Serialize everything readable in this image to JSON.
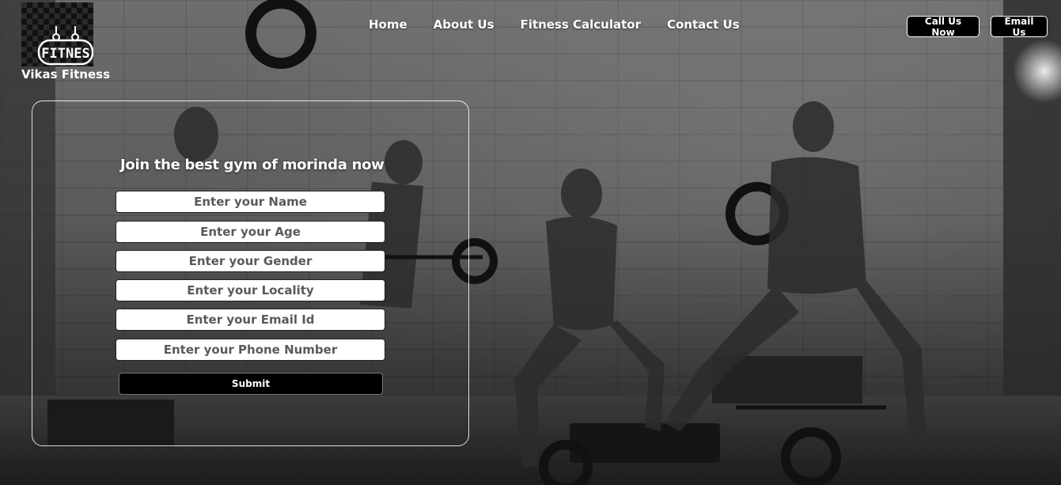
{
  "brand": {
    "logo_text": "FITNES",
    "name": "Vikas Fitness"
  },
  "nav": {
    "items": [
      {
        "label": "Home"
      },
      {
        "label": "About Us"
      },
      {
        "label": "Fitness Calculator"
      },
      {
        "label": "Contact Us"
      }
    ]
  },
  "actions": {
    "call_label": "Call Us Now",
    "email_label": "Email Us"
  },
  "form": {
    "title": "Join the best gym of morinda now",
    "fields": [
      {
        "placeholder": "Enter your Name",
        "value": ""
      },
      {
        "placeholder": "Enter your Age",
        "value": ""
      },
      {
        "placeholder": "Enter your Gender",
        "value": ""
      },
      {
        "placeholder": "Enter your Locality",
        "value": ""
      },
      {
        "placeholder": "Enter your Email Id",
        "value": ""
      },
      {
        "placeholder": "Enter your Phone Number",
        "value": ""
      }
    ],
    "submit_label": "Submit"
  },
  "colors": {
    "background": "#4a4a4a",
    "button_bg": "#000000",
    "text": "#ffffff"
  }
}
